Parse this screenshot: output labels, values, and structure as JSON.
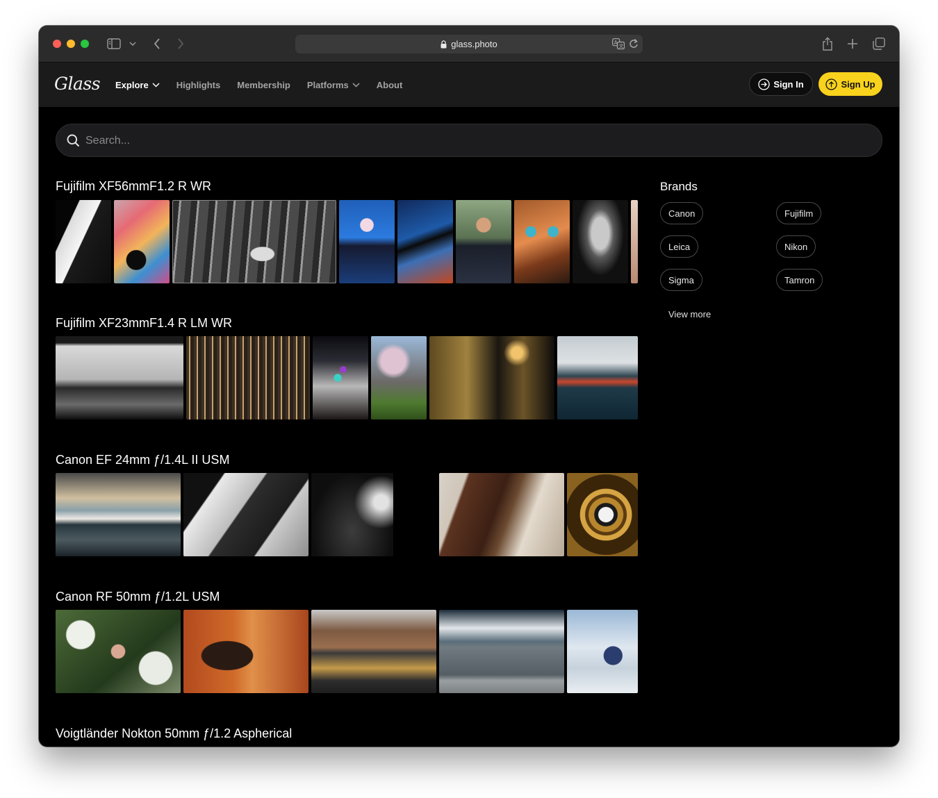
{
  "browser": {
    "url": "glass.photo"
  },
  "site": {
    "logo": "Glass",
    "nav": [
      {
        "label": "Explore"
      },
      {
        "label": "Highlights"
      },
      {
        "label": "Membership"
      },
      {
        "label": "Platforms"
      },
      {
        "label": "About"
      }
    ],
    "sign_in": "Sign In",
    "sign_up": "Sign Up"
  },
  "search": {
    "placeholder": "Search..."
  },
  "lenses": [
    {
      "title": "Fujifilm XF56mmF1.2 R WR"
    },
    {
      "title": "Fujifilm XF23mmF1.4 R LM WR"
    },
    {
      "title": "Canon EF 24mm ƒ/1.4L II USM"
    },
    {
      "title": "Canon RF 50mm ƒ/1.2L USM"
    },
    {
      "title": "Voigtländer Nokton 50mm ƒ/1.2 Aspherical"
    }
  ],
  "brands": {
    "title": "Brands",
    "items": [
      {
        "label": "Canon"
      },
      {
        "label": "Fujifilm"
      },
      {
        "label": "Leica"
      },
      {
        "label": "Nikon"
      },
      {
        "label": "Sigma"
      },
      {
        "label": "Tamron"
      }
    ],
    "view_more": "View more"
  }
}
